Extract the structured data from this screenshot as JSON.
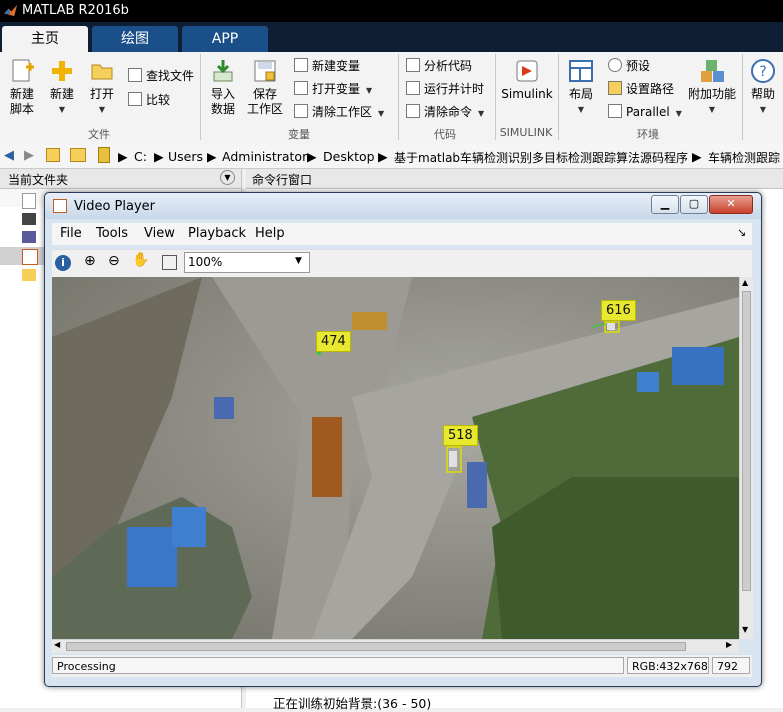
{
  "app": {
    "title": "MATLAB R2016b"
  },
  "tabs": [
    {
      "label": "主页",
      "active": true
    },
    {
      "label": "绘图",
      "active": false
    },
    {
      "label": "APP",
      "active": false
    }
  ],
  "ribbon": {
    "new_script": "新建\n脚本",
    "new": "新建",
    "open": "打开",
    "find_files": "查找文件",
    "compare": "比较",
    "import_data": "导入\n数据",
    "save_workspace": "保存\n工作区",
    "new_variable": "新建变量",
    "open_variable": "打开变量",
    "clear_workspace": "清除工作区",
    "analyze_code": "分析代码",
    "run_and_time": "运行并计时",
    "clear_commands": "清除命令",
    "simulink": "Simulink",
    "layout": "布局",
    "preferences": "预设",
    "set_path": "设置路径",
    "parallel": "Parallel",
    "add_ons": "附加功能",
    "help": "帮助",
    "groups": {
      "file": "文件",
      "variable": "变量",
      "code": "代码",
      "simulink": "SIMULINK",
      "environment": "环境"
    }
  },
  "address": {
    "parts": [
      "C:",
      "Users",
      "Administrator",
      "Desktop",
      "基于matlab车辆检测识别多目标检测跟踪算法源码程序",
      "车辆检测跟踪"
    ]
  },
  "left_panel": {
    "title": "当前文件夹"
  },
  "command_window": {
    "title": "命令行窗口",
    "last_line": "正在训练初始背景:(36 - 50)"
  },
  "video_player": {
    "title": "Video Player",
    "menu": [
      "File",
      "Tools",
      "View",
      "Playback",
      "Help"
    ],
    "zoom": "100%",
    "status": {
      "state": "Processing",
      "info": "RGB:432x768",
      "frame": "792"
    },
    "tracks": [
      {
        "id": "474"
      },
      {
        "id": "616"
      },
      {
        "id": "518"
      }
    ]
  },
  "icons": {
    "matlab_logo": "matlab-logo-icon",
    "colors": {
      "tab_active_bg": "#f3f3f3",
      "tab_bg": "#1b4f89",
      "label_yellow": "#e8e830"
    }
  }
}
